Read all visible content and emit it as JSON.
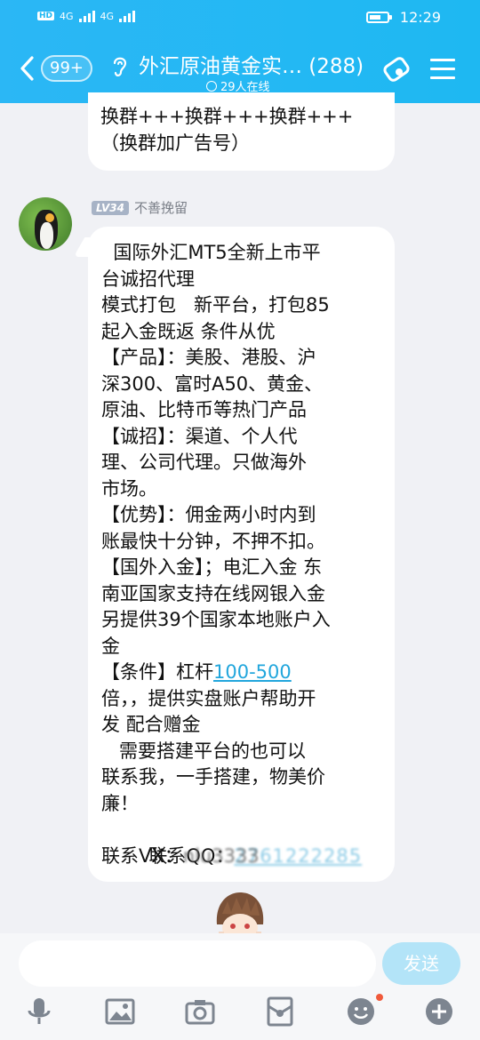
{
  "status": {
    "left_text": "HD",
    "net1": "4G",
    "net2": "4G",
    "time": "12:29"
  },
  "header": {
    "badge": "99+",
    "title": "外汇原油黄金实… (288)",
    "online": "29人在线"
  },
  "messages": [
    {
      "lines": [
        "换群+++换群+++换群+++",
        "（换群加广告号）"
      ]
    },
    {
      "level": "LV34",
      "sender": "不善挽留",
      "lines": [
        "  国际外汇MT5全新上市平",
        "台诚招代理",
        "模式打包   新平台，打包85",
        "起入金既返 条件从优",
        "【产品】：美股、港股、沪",
        "深300、富时A50、黄金、",
        "原油、比特币等热门产品",
        "【诚招】：渠道、个人代",
        "理、公司代理。只做海外",
        "市场。",
        "【优势】：佣金两小时内到",
        "账最快十分钟，不押不扣。",
        "【国外入金】；电汇入金 东",
        "南亚国家支持在线网银入金",
        "另提供39个国家本地账户入",
        "金"
      ],
      "cond_prefix": "【条件】杠杆",
      "cond_link": "100-500",
      "lines2": [
        "倍，，提供实盘账户帮助开",
        "发 配合赠金",
        "   需要搭建平台的也可以",
        "联系我，一手搭建，物美价",
        "廉！"
      ],
      "qq_label": "        联系QQ：",
      "qq_value": "2761222285",
      "vx_label": "联系VX：",
      "vx_value": "nlu3333"
    }
  ],
  "input": {
    "placeholder": "",
    "send_label": "发送"
  },
  "toolbar": [
    "mic-icon",
    "image-icon",
    "camera-icon",
    "redpacket-icon",
    "emoji-icon",
    "plus-icon"
  ],
  "colors": {
    "header": "#1eb8f2",
    "link": "#21a6dc",
    "send": "#b3e4f8"
  }
}
